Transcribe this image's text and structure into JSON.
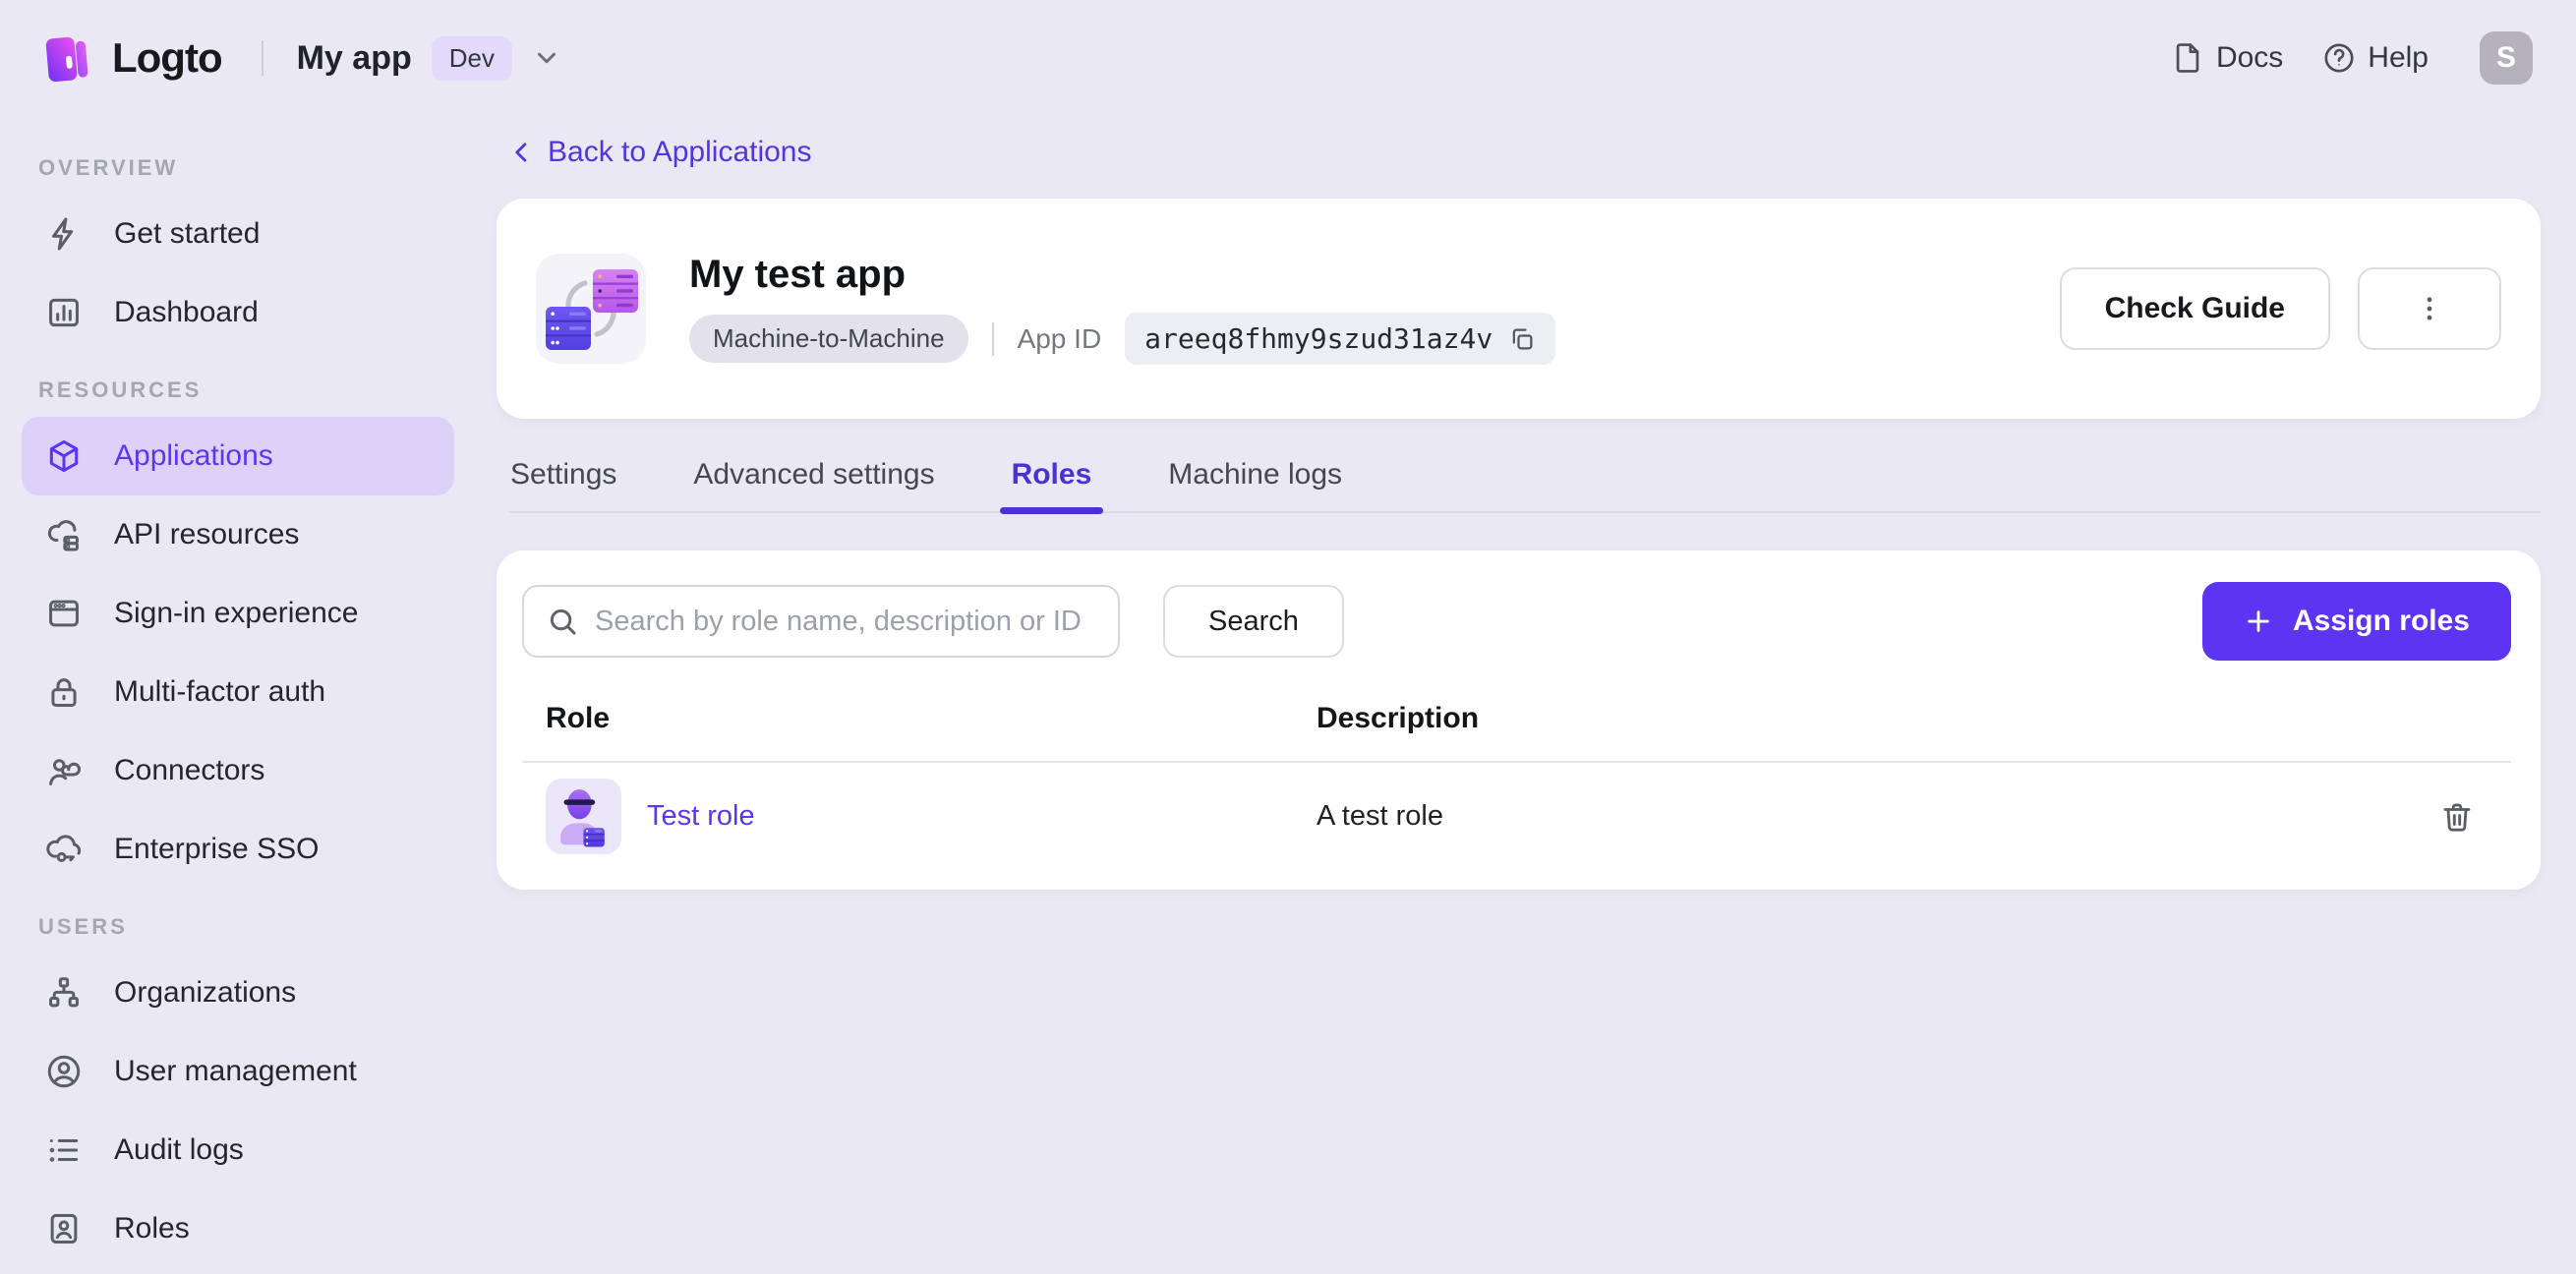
{
  "header": {
    "brand": "Logto",
    "app_name": "My app",
    "env_badge": "Dev",
    "docs_label": "Docs",
    "help_label": "Help",
    "avatar_letter": "S"
  },
  "sidebar": {
    "sections": [
      {
        "label": "OVERVIEW",
        "items": [
          {
            "label": "Get started",
            "icon": "lightning-icon",
            "active": false
          },
          {
            "label": "Dashboard",
            "icon": "bar-chart-icon",
            "active": false
          }
        ]
      },
      {
        "label": "RESOURCES",
        "items": [
          {
            "label": "Applications",
            "icon": "cube-icon",
            "active": true
          },
          {
            "label": "API resources",
            "icon": "cloud-server-icon",
            "active": false
          },
          {
            "label": "Sign-in experience",
            "icon": "browser-window-icon",
            "active": false
          },
          {
            "label": "Multi-factor auth",
            "icon": "lock-icon",
            "active": false
          },
          {
            "label": "Connectors",
            "icon": "person-cloud-icon",
            "active": false
          },
          {
            "label": "Enterprise SSO",
            "icon": "cloud-key-icon",
            "active": false
          }
        ]
      },
      {
        "label": "USERS",
        "items": [
          {
            "label": "Organizations",
            "icon": "org-chart-icon",
            "active": false
          },
          {
            "label": "User management",
            "icon": "user-circle-icon",
            "active": false
          },
          {
            "label": "Audit logs",
            "icon": "list-icon",
            "active": false
          },
          {
            "label": "Roles",
            "icon": "id-card-icon",
            "active": false
          }
        ]
      }
    ]
  },
  "page": {
    "back_link": "Back to Applications"
  },
  "app_card": {
    "title": "My test app",
    "type_badge": "Machine-to-Machine",
    "app_id_label": "App ID",
    "app_id_value": "areeq8fhmy9szud31az4v",
    "check_guide_label": "Check Guide"
  },
  "tabs": [
    {
      "label": "Settings",
      "active": false
    },
    {
      "label": "Advanced settings",
      "active": false
    },
    {
      "label": "Roles",
      "active": true
    },
    {
      "label": "Machine logs",
      "active": false
    }
  ],
  "toolbar": {
    "search_placeholder": "Search by role name, description or ID",
    "search_button_label": "Search",
    "assign_roles_label": "Assign roles"
  },
  "roles_table": {
    "columns": {
      "role": "Role",
      "description": "Description"
    },
    "rows": [
      {
        "role_name": "Test role",
        "description": "A test role"
      }
    ]
  },
  "colors": {
    "accent": "#5d34f2",
    "tab_active": "#4c30d4",
    "page_background": "#eae8f4",
    "sidebar_active_background": "#dcd2f9",
    "card_background": "#ffffff"
  }
}
